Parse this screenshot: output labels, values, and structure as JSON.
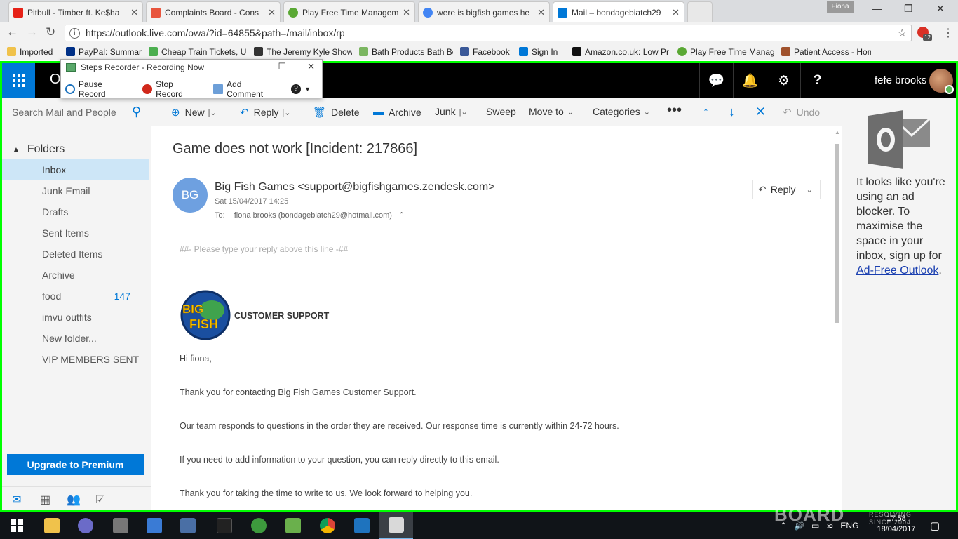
{
  "browser": {
    "tabs": [
      {
        "title": "Pitbull - Timber ft. Ke$ha",
        "favicon_color": "#e62117"
      },
      {
        "title": "Complaints Board - Cons",
        "favicon_color": "#e8553e"
      },
      {
        "title": "Play Free Time Managem",
        "favicon_color": "#5aa834"
      },
      {
        "title": "were is bigfish games he",
        "favicon_color": "#4285f4"
      },
      {
        "title": "Mail – bondagebiatch29",
        "favicon_color": "#0078d7"
      }
    ],
    "profile_name": "Fiona",
    "url": "https://outlook.live.com/owa/?id=64855&path=/mail/inbox/rp",
    "extension_badge": "12",
    "bookmarks": [
      {
        "label": "Imported",
        "color": "#f0c24b"
      },
      {
        "label": "PayPal: Summary",
        "color": "#003087"
      },
      {
        "label": "Cheap Train Tickets, U",
        "color": "#4caf50"
      },
      {
        "label": "The Jeremy Kyle Show",
        "color": "#333333"
      },
      {
        "label": "Bath Products Bath Bo",
        "color": "#7bb661"
      },
      {
        "label": "Facebook",
        "color": "#3b5998"
      },
      {
        "label": "Sign In",
        "color": "#0078d7"
      },
      {
        "label": "Amazon.co.uk: Low Pr",
        "color": "#111111"
      },
      {
        "label": "Play Free Time Manag",
        "color": "#5aa834"
      },
      {
        "label": "Patient Access - Home",
        "color": "#a0522d"
      }
    ]
  },
  "steps_recorder": {
    "title": "Steps Recorder - Recording Now",
    "pause": "Pause Record",
    "stop": "Stop Record",
    "comment": "Add Comment"
  },
  "header": {
    "app_letter": "O",
    "user": "fefe brooks"
  },
  "search": {
    "placeholder": "Search Mail and People"
  },
  "folders": {
    "heading": "Folders",
    "items": [
      {
        "label": "Inbox",
        "count": ""
      },
      {
        "label": "Junk Email",
        "count": ""
      },
      {
        "label": "Drafts",
        "count": ""
      },
      {
        "label": "Sent Items",
        "count": ""
      },
      {
        "label": "Deleted Items",
        "count": ""
      },
      {
        "label": "Archive",
        "count": ""
      },
      {
        "label": "food",
        "count": "147"
      },
      {
        "label": "imvu outfits",
        "count": ""
      },
      {
        "label": "New folder...",
        "count": ""
      },
      {
        "label": "VIP MEMBERS SENT",
        "count": ""
      }
    ]
  },
  "upgrade_label": "Upgrade to Premium",
  "commands": {
    "new": "New",
    "reply": "Reply",
    "delete": "Delete",
    "archive": "Archive",
    "junk": "Junk",
    "sweep": "Sweep",
    "move_to": "Move to",
    "categories": "Categories",
    "undo": "Undo"
  },
  "message": {
    "subject": "Game does not work [Incident: 217866]",
    "sender_initials": "BG",
    "sender": "Big Fish Games <support@bigfishgames.zendesk.com>",
    "date": "Sat 15/04/2017 14:25",
    "to_label": "To:",
    "to": "fiona brooks (bondagebiatch29@hotmail.com)",
    "reply_label": "Reply",
    "reply_line": "##- Please type your reply above this line -##",
    "logo_text": "BIG FISH",
    "support_label": "CUSTOMER SUPPORT",
    "paragraphs": [
      "Hi fiona,",
      "Thank you for contacting Big Fish Games Customer Support.",
      "Our team responds to questions in the order they are received. Our response time is currently within 24-72 hours.",
      "If you need to add information to your question, you can reply directly to this email.",
      "Thank you for taking the time to write to us. We look forward to helping you."
    ]
  },
  "ad": {
    "text": "It looks like you're using an ad blocker. To maximise the space in your inbox, sign up for ",
    "link": "Ad-Free Outlook"
  },
  "taskbar": {
    "apps": [
      {
        "name": "file-explorer",
        "color": "#f0c24b"
      },
      {
        "name": "app-swirl",
        "color": "#6b6bc8"
      },
      {
        "name": "app-drone",
        "color": "#777777"
      },
      {
        "name": "app-paint",
        "color": "#3a7bd5"
      },
      {
        "name": "app-editor",
        "color": "#4a6fa5"
      },
      {
        "name": "app-kindle",
        "color": "#222222"
      },
      {
        "name": "app-globe",
        "color": "#3d9a3d"
      },
      {
        "name": "app-w",
        "color": "#6ab04c"
      },
      {
        "name": "chrome",
        "color": "#db4437"
      },
      {
        "name": "app-window",
        "color": "#1e73be"
      },
      {
        "name": "steps-recorder",
        "color": "#d9d9d9"
      }
    ],
    "language": "ENG",
    "time": "17:58",
    "date": "18/04/2017"
  },
  "watermark": {
    "brand": "BOARD",
    "tag1": "RESOLVING",
    "tag2": "SINCE 2004"
  }
}
